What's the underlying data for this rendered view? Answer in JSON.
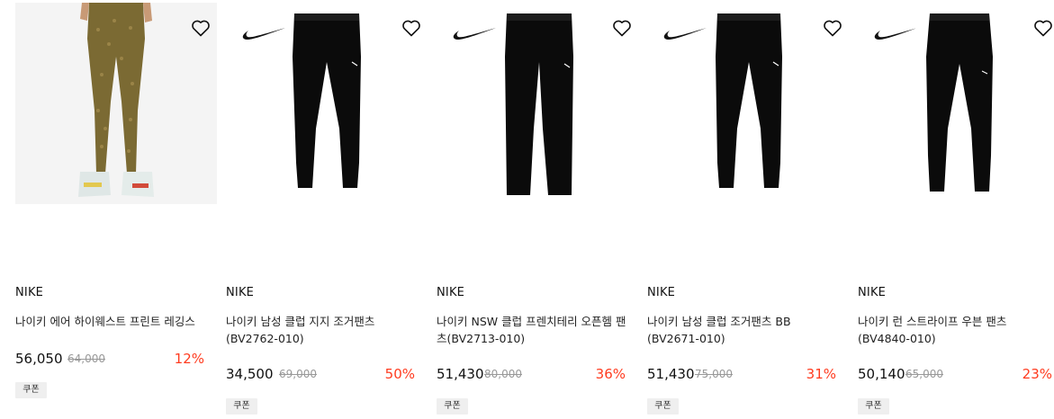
{
  "products": [
    {
      "brand": "NIKE",
      "name": "나이키 에어 하이웨스트 프린트 레깅스",
      "price": "56,050",
      "original_price": "64,000",
      "discount": "12%",
      "coupon": "쿠폰"
    },
    {
      "brand": "NIKE",
      "name": "나이키 남성 클럽 지지 조거팬츠 (BV2762-010)",
      "price": "34,500",
      "original_price": "69,000",
      "discount": "50%",
      "coupon": "쿠폰"
    },
    {
      "brand": "NIKE",
      "name": "나이키 NSW 클럽 프렌치테리 오픈헴 팬츠(BV2713-010)",
      "price": "51,430",
      "original_price": "80,000",
      "discount": "36%",
      "coupon": "쿠폰"
    },
    {
      "brand": "NIKE",
      "name": "나이키 남성 클럽 조거팬츠 BB (BV2671-010)",
      "price": "51,430",
      "original_price": "75,000",
      "discount": "31%",
      "coupon": "쿠폰"
    },
    {
      "brand": "NIKE",
      "name": "나이키 런 스트라이프 우븐 팬츠 (BV4840-010)",
      "price": "50,140",
      "original_price": "65,000",
      "discount": "23%",
      "coupon": "쿠폰"
    }
  ],
  "colors": {
    "discount": "#ff3b1f",
    "legging": "#7b6a33",
    "pants": "#0b0b0b"
  },
  "icons": {
    "wishlist": "heart-outline-icon",
    "brand_logo": "nike-swoosh-icon"
  }
}
